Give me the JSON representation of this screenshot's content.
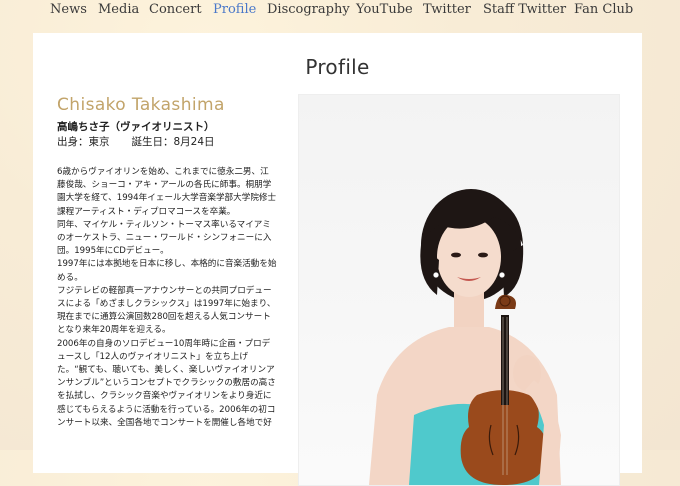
{
  "nav": {
    "items": [
      {
        "label": "News",
        "active": false
      },
      {
        "label": "Media",
        "active": false
      },
      {
        "label": "Concert",
        "active": false
      },
      {
        "label": "Profile",
        "active": true
      },
      {
        "label": "Discography",
        "active": false
      },
      {
        "label": "YouTube",
        "active": false
      },
      {
        "label": "Twitter",
        "active": false
      },
      {
        "label": "Staff Twitter",
        "active": false
      },
      {
        "label": "Fan Club",
        "active": false
      }
    ],
    "active_color": "#4a78c9"
  },
  "page": {
    "title": "Profile"
  },
  "profile": {
    "name_en": "Chisako Takashima",
    "name_jp": "高嶋ちさ子（ヴァイオリニスト）",
    "birthplace": "出身：東京",
    "birthday": "誕生日：8月24日",
    "bio_lines": [
      "6歳からヴァイオリンを始め、これまでに徳永二男、江",
      "藤俊哉、ショーコ・アキ・アールの各氏に師事。桐朋学",
      "園大学を経て、1994年イェール大学音楽学部大学院修士",
      "課程アーティスト・ディプロマコースを卒業。",
      "同年、マイケル・ティルソン・トーマス率いるマイアミ",
      "のオーケストラ、ニュー・ワールド・シンフォニーに入",
      "団。1995年にCDデビュー。",
      "1997年には本拠地を日本に移し、本格的に音楽活動を始",
      "める。",
      "フジテレビの軽部真一アナウンサーとの共同プロデュー",
      "スによる「めざましクラシックス」は1997年に始まり、",
      "現在までに通算公演回数280回を超える人気コンサート",
      "となり来年20周年を迎える。",
      "2006年の自身のソロデビュー10周年時に企画・プロデ",
      "ュースし「12人のヴァイオリニスト」を立ち上げ",
      "た。“観ても、聴いても、美しく、楽しいヴァイオリンア",
      "ンサンブル”というコンセプトでクラシックの敷居の高さ",
      "を払拭し、クラシック音楽やヴァイオリンをより身近に",
      "感じてもらえるように活動を行っている。2006年の初コ",
      "ンサート以来、全国各地でコンサートを開催し各地で好"
    ]
  },
  "colors": {
    "name_accent": "#c2a46a",
    "dress": "#4fc9cc",
    "violin": "#9a4a1c"
  }
}
